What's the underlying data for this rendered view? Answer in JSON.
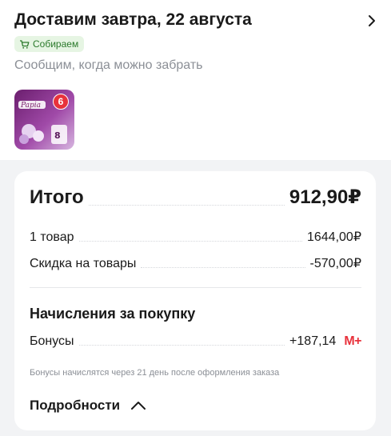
{
  "delivery": {
    "title": "Доставим завтра, 22 августа",
    "status": "Собираем",
    "subtitle": "Сообщим, когда можно забрать",
    "product": {
      "image_brand": "Papia",
      "quantity": "6"
    }
  },
  "summary": {
    "total_label": "Итого",
    "total_value": "912,90₽",
    "items_label": "1 товар",
    "items_value": "1644,00₽",
    "discount_label": "Скидка на товары",
    "discount_value": "-570,00₽",
    "accruals_title": "Начисления за покупку",
    "bonus_label": "Бонусы",
    "bonus_value": "+187,14",
    "bonus_badge": "M+",
    "bonus_note": "Бонусы начислятся через 21 день после оформления заказа",
    "details_label": "Подробности"
  },
  "colors": {
    "accent_red": "#e8323c",
    "badge_green_bg": "#e6f5e3",
    "badge_green_text": "#2c7a2c",
    "page_bg": "#f2f3f5"
  },
  "icons": [
    "chevron-right-icon",
    "cart-icon",
    "chevron-up-icon"
  ]
}
